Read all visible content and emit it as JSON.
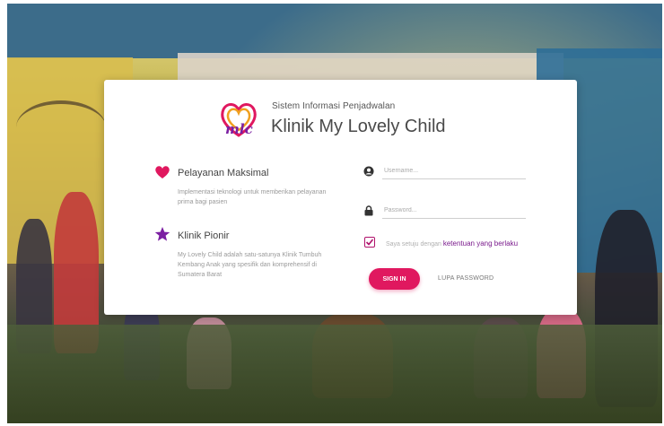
{
  "header": {
    "subtitle": "Sistem Informasi Penjadwalan",
    "title": "Klinik My Lovely Child"
  },
  "features": [
    {
      "icon": "heart-icon",
      "title": "Pelayanan Maksimal",
      "description": "Implementasi teknologi untuk memberikan pelayanan prima bagi pasien"
    },
    {
      "icon": "star-icon",
      "title": "Klinik Pionir",
      "description": "My Lovely Child adalah satu-satunya Klinik Tumbuh Kembang Anak yang spesifik dan komprehensif di Sumatera Barat"
    }
  ],
  "form": {
    "username_placeholder": "Username...",
    "password_placeholder": "Password...",
    "agree_text": "Saya setuju dengan",
    "agree_link": "ketentuan yang berlaku",
    "agree_checked": true,
    "signin_label": "SIGN IN",
    "forgot_label": "LUPA PASSWORD"
  },
  "colors": {
    "accent": "#e0185f",
    "link": "#7a1a8c",
    "star": "#7b1fa2"
  }
}
